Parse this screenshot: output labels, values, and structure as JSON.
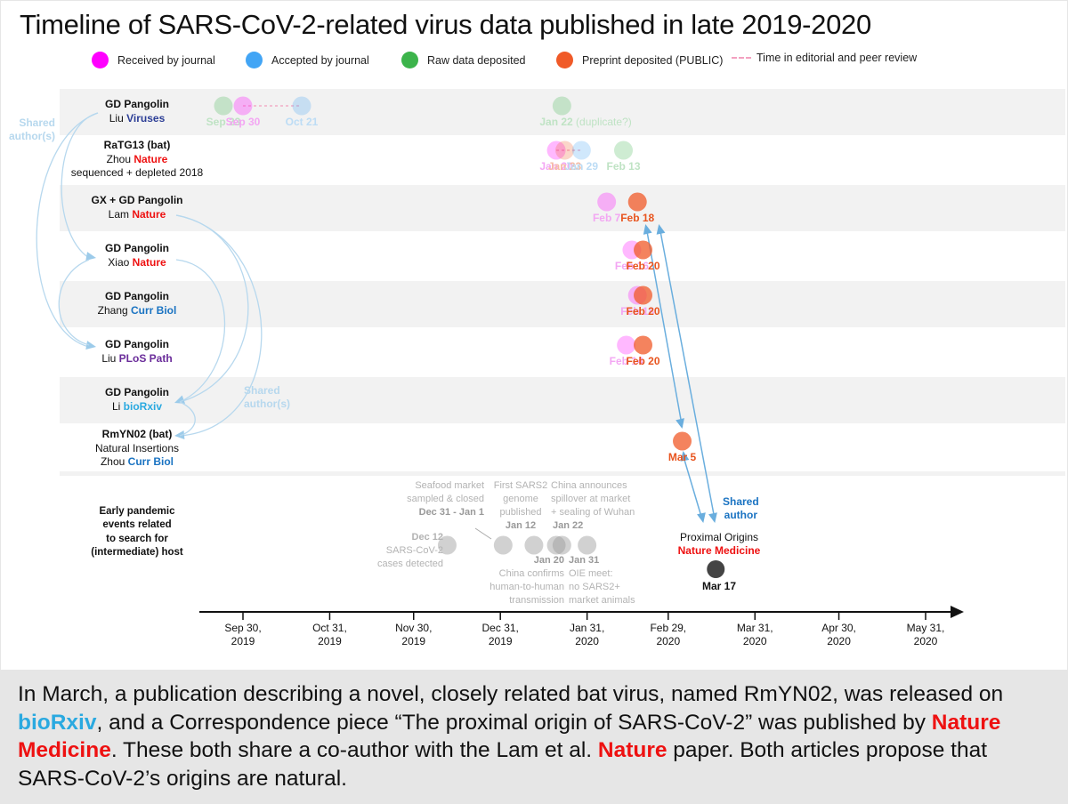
{
  "title": "Timeline of SARS-CoV-2-related virus data published in late 2019-2020",
  "legend": [
    {
      "label": "Received by journal",
      "color": "#ff00ff",
      "kind": "dot"
    },
    {
      "label": "Accepted by journal",
      "color": "#42a5f5",
      "kind": "dot"
    },
    {
      "label": "Raw data deposited",
      "color": "#3cb44b",
      "kind": "dot"
    },
    {
      "label": "Preprint deposited (PUBLIC)",
      "color": "#f05a28",
      "kind": "dot"
    },
    {
      "label": "Time in editorial and peer review",
      "color": "#f3a1c0",
      "kind": "dash"
    }
  ],
  "rows": [
    {
      "line1": "GD Pangolin",
      "author": "Liu",
      "journal": "Viruses",
      "journal_color": "#2c3e96",
      "line3": ""
    },
    {
      "line1": "RaTG13 (bat)",
      "author": "Zhou",
      "journal": "Nature",
      "journal_color": "#ee1111",
      "line3": "sequenced + depleted 2018"
    },
    {
      "line1": "GX + GD Pangolin",
      "author": "Lam",
      "journal": "Nature",
      "journal_color": "#ee1111",
      "line3": ""
    },
    {
      "line1": "GD Pangolin",
      "author": "Xiao",
      "journal": "Nature",
      "journal_color": "#ee1111",
      "line3": ""
    },
    {
      "line1": "GD Pangolin",
      "author": "Zhang",
      "journal": "Curr Biol",
      "journal_color": "#1a73c2",
      "line3": ""
    },
    {
      "line1": "GD Pangolin",
      "author": "Liu",
      "journal": "PLoS Path",
      "journal_color": "#6a2c9a",
      "line3": ""
    },
    {
      "line1": "GD Pangolin",
      "author": "Li",
      "journal": "bioRxiv",
      "journal_color": "#2aa9e0",
      "line3": ""
    },
    {
      "line1": "RmYN02 (bat)",
      "author": "Zhou",
      "journal": "Curr Biol",
      "journal_color": "#1a73c2",
      "line2_prefix": "Natural Insertions",
      "line3": ""
    }
  ],
  "events_row_label": [
    "Early pandemic",
    "events related",
    "to search for",
    "(intermediate) host"
  ],
  "shared_labels": {
    "left": [
      "Shared",
      "author(s)"
    ],
    "middle": [
      "Shared",
      "author(s)"
    ],
    "right": [
      "Shared",
      "author"
    ]
  },
  "proximal": {
    "line1": "Proximal Origins",
    "line2": "Nature Medicine",
    "date": "Mar 17"
  },
  "early_events": [
    {
      "date_label": "Dec 12",
      "text": [
        "SARS-CoV-2",
        "cases detected"
      ]
    },
    {
      "date_label": "Dec 31 - Jan 1",
      "text": [
        "Seafood market",
        "sampled & closed"
      ]
    },
    {
      "date_label": "Jan 12",
      "text": [
        "First SARS2",
        "genome",
        "published"
      ]
    },
    {
      "date_label": "Jan 20",
      "text": [
        "China confirms",
        "human-to-human",
        "transmission"
      ]
    },
    {
      "date_label": "Jan 22",
      "text": [
        "China announces",
        "spillover at market",
        "+ sealing of Wuhan"
      ]
    },
    {
      "date_label": "Jan 31",
      "text": [
        "OIE meet:",
        "no SARS2+",
        "market animals"
      ]
    }
  ],
  "caption": {
    "p1": "In March, a publication describing a novel, closely related bat virus, named RmYN02, was released on ",
    "bioRxiv": "bioRxiv",
    "p2": ", and a Correspondence piece “The proximal origin of SARS-CoV-2” was published by ",
    "natmed": "Nature Medicine",
    "p3": ". These both share a co-author with the Lam et al. ",
    "nature": "Nature",
    "p4": " paper. Both articles propose that SARS-CoV-2’s origins are natural."
  },
  "chart_data": {
    "type": "scatter",
    "title": "Timeline of SARS-CoV-2-related virus data published in late 2019-2020",
    "x_axis": {
      "type": "date",
      "range": [
        "2019-09-10",
        "2020-06-15"
      ],
      "ticks": [
        "2019-09-30",
        "2019-10-31",
        "2019-11-30",
        "2019-12-31",
        "2020-01-31",
        "2020-02-29",
        "2020-03-31",
        "2020-04-30",
        "2020-05-31"
      ],
      "tick_labels": [
        [
          "Sep 30,",
          "2019"
        ],
        [
          "Oct 31,",
          "2019"
        ],
        [
          "Nov 30,",
          "2019"
        ],
        [
          "Dec 31,",
          "2019"
        ],
        [
          "Jan 31,",
          "2020"
        ],
        [
          "Feb 29,",
          "2020"
        ],
        [
          "Mar 31,",
          "2020"
        ],
        [
          "Apr 30,",
          "2020"
        ],
        [
          "May 31,",
          "2020"
        ]
      ]
    },
    "categories": {
      "received": {
        "color": "#ff00ff"
      },
      "accepted": {
        "color": "#42a5f5"
      },
      "raw": {
        "color": "#3cb44b"
      },
      "preprint": {
        "color": "#f05a28"
      },
      "event": {
        "color": "#999999"
      },
      "publication": {
        "color": "#333333"
      }
    },
    "series": [
      {
        "row": 0,
        "points": [
          {
            "date": "2019-09-23",
            "kind": "raw",
            "label": "Sep 23",
            "faded": true
          },
          {
            "date": "2019-09-30",
            "kind": "received",
            "label": "Sep 30",
            "faded": true
          },
          {
            "date": "2019-10-21",
            "kind": "accepted",
            "label": "Oct 21",
            "faded": true
          },
          {
            "date": "2020-01-22",
            "kind": "raw",
            "label": "Jan 22",
            "suffix": " (duplicate?)",
            "faded": true
          }
        ],
        "review_span": [
          "2019-09-30",
          "2019-10-21"
        ]
      },
      {
        "row": 1,
        "points": [
          {
            "date": "2020-01-20",
            "kind": "received",
            "label": "Jan 20",
            "faded": true
          },
          {
            "date": "2020-01-23",
            "kind": "preprint",
            "label": "Jan 23",
            "faded": true
          },
          {
            "date": "2020-01-29",
            "kind": "accepted",
            "label": "Jan 29",
            "faded": true
          },
          {
            "date": "2020-02-13",
            "kind": "raw",
            "label": "Feb 13",
            "faded": true
          }
        ],
        "review_span": [
          "2020-01-20",
          "2020-01-29"
        ]
      },
      {
        "row": 2,
        "points": [
          {
            "date": "2020-02-07",
            "kind": "received",
            "label": "Feb 7",
            "faded": true
          },
          {
            "date": "2020-02-18",
            "kind": "preprint",
            "label": "Feb 18",
            "faded": false
          }
        ]
      },
      {
        "row": 3,
        "points": [
          {
            "date": "2020-02-16",
            "kind": "received",
            "label": "Feb 16",
            "faded": true
          },
          {
            "date": "2020-02-20",
            "kind": "preprint",
            "label": "Feb 20",
            "faded": false
          }
        ]
      },
      {
        "row": 4,
        "points": [
          {
            "date": "2020-02-18",
            "kind": "received",
            "label": "Feb 18",
            "faded": true
          },
          {
            "date": "2020-02-20",
            "kind": "preprint",
            "label": "Feb 20",
            "faded": false
          }
        ]
      },
      {
        "row": 5,
        "points": [
          {
            "date": "2020-02-14",
            "kind": "received",
            "label": "Feb 14",
            "faded": true
          },
          {
            "date": "2020-02-20",
            "kind": "preprint",
            "label": "Feb 20",
            "faded": false
          }
        ]
      },
      {
        "row": 7,
        "points": [
          {
            "date": "2020-03-05",
            "kind": "preprint",
            "label": "Mar 5",
            "faded": false
          }
        ]
      }
    ],
    "events": [
      {
        "date": "2019-12-12",
        "label": "Dec 12"
      },
      {
        "date": "2020-01-01",
        "label": "Dec 31 - Jan 1"
      },
      {
        "date": "2020-01-12",
        "label": "Jan 12"
      },
      {
        "date": "2020-01-20",
        "label": "Jan 20"
      },
      {
        "date": "2020-01-22",
        "label": "Jan 22"
      },
      {
        "date": "2020-01-31",
        "label": "Jan 31"
      }
    ],
    "publication": {
      "date": "2020-03-17",
      "label": "Mar 17",
      "name": "Proximal Origins",
      "journal": "Nature Medicine"
    }
  }
}
